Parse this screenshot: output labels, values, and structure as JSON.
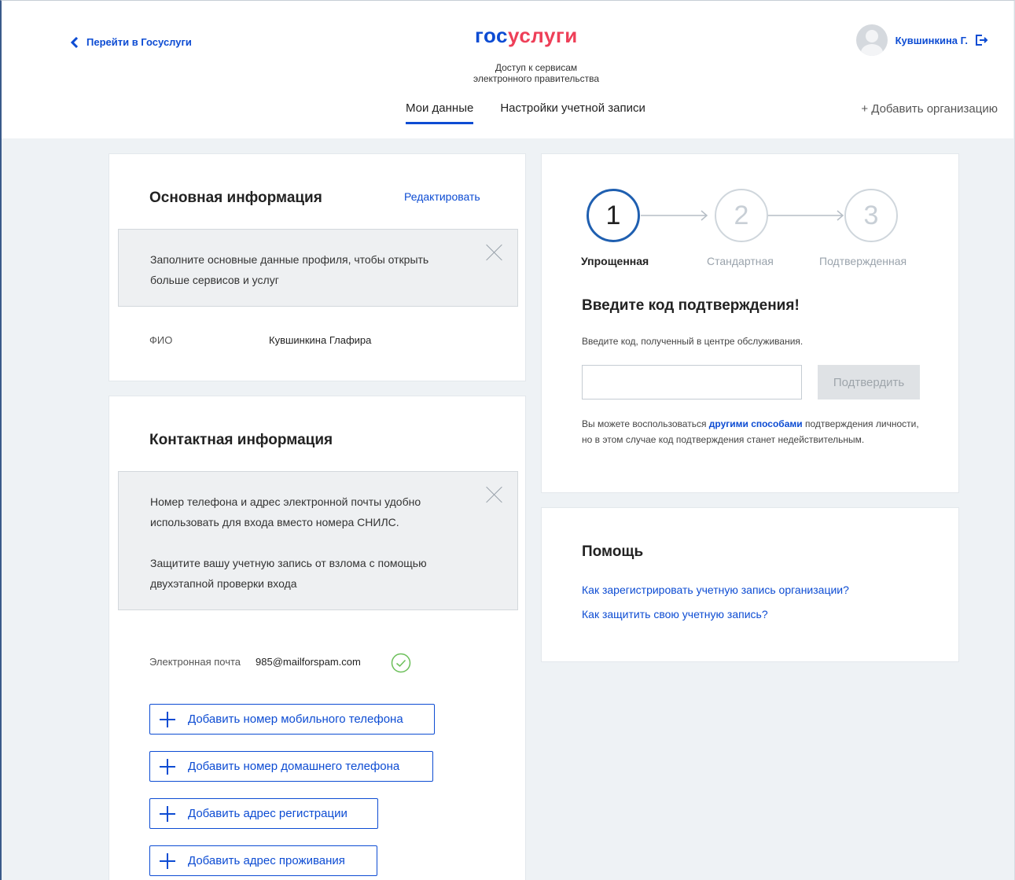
{
  "header": {
    "back_label": "Перейти в Госуслуги",
    "logo_part1": "гос",
    "logo_part2": "услуги",
    "tagline_line1": "Доступ к сервисам",
    "tagline_line2": "электронного правительства",
    "user_name": "Кувшинкина Г.",
    "tabs": [
      {
        "label": "Мои данные",
        "active": true
      },
      {
        "label": "Настройки учетной записи",
        "active": false
      }
    ],
    "add_org": "+ Добавить организацию"
  },
  "main_info": {
    "title": "Основная информация",
    "edit_link": "Редактировать",
    "notice": "Заполните основные данные профиля, чтобы открыть больше сервисов и услуг",
    "fio_label": "ФИО",
    "fio_value": "Кувшинкина Глафира"
  },
  "contact_info": {
    "title": "Контактная информация",
    "notice_p1": "Номер телефона и адрес электронной почты удобно использовать для входа вместо номера СНИЛС.",
    "notice_p2": "Защитите вашу учетную запись от взлома с помощью двухэтапной проверки входа",
    "email_label": "Электронная почта",
    "email_value": "985@mailforspam.com",
    "buttons": [
      "Добавить номер мобильного телефона",
      "Добавить номер домашнего телефона",
      "Добавить адрес регистрации",
      "Добавить адрес проживания"
    ]
  },
  "verification": {
    "steps": [
      {
        "num": "1",
        "label": "Упрощенная",
        "active": true
      },
      {
        "num": "2",
        "label": "Стандартная",
        "active": false
      },
      {
        "num": "3",
        "label": "Подтвержденная",
        "active": false
      }
    ],
    "title": "Введите код подтверждения!",
    "subtitle": "Введите код, полученный в центре обслуживания.",
    "input_value": "",
    "confirm_button": "Подтвердить",
    "note_before": "Вы можете воспользоваться",
    "note_link": "другими способами",
    "note_after": "подтверждения личности, но в этом случае код подтверждения станет недействительным."
  },
  "help": {
    "title": "Помощь",
    "links": [
      "Как зарегистрировать учетную запись организации?",
      "Как защитить свою учетную запись?"
    ]
  },
  "colors": {
    "accent": "#0d4cd3",
    "logo_red": "#ee3f58",
    "success": "#6bbf59",
    "background": "#eef2f5"
  }
}
